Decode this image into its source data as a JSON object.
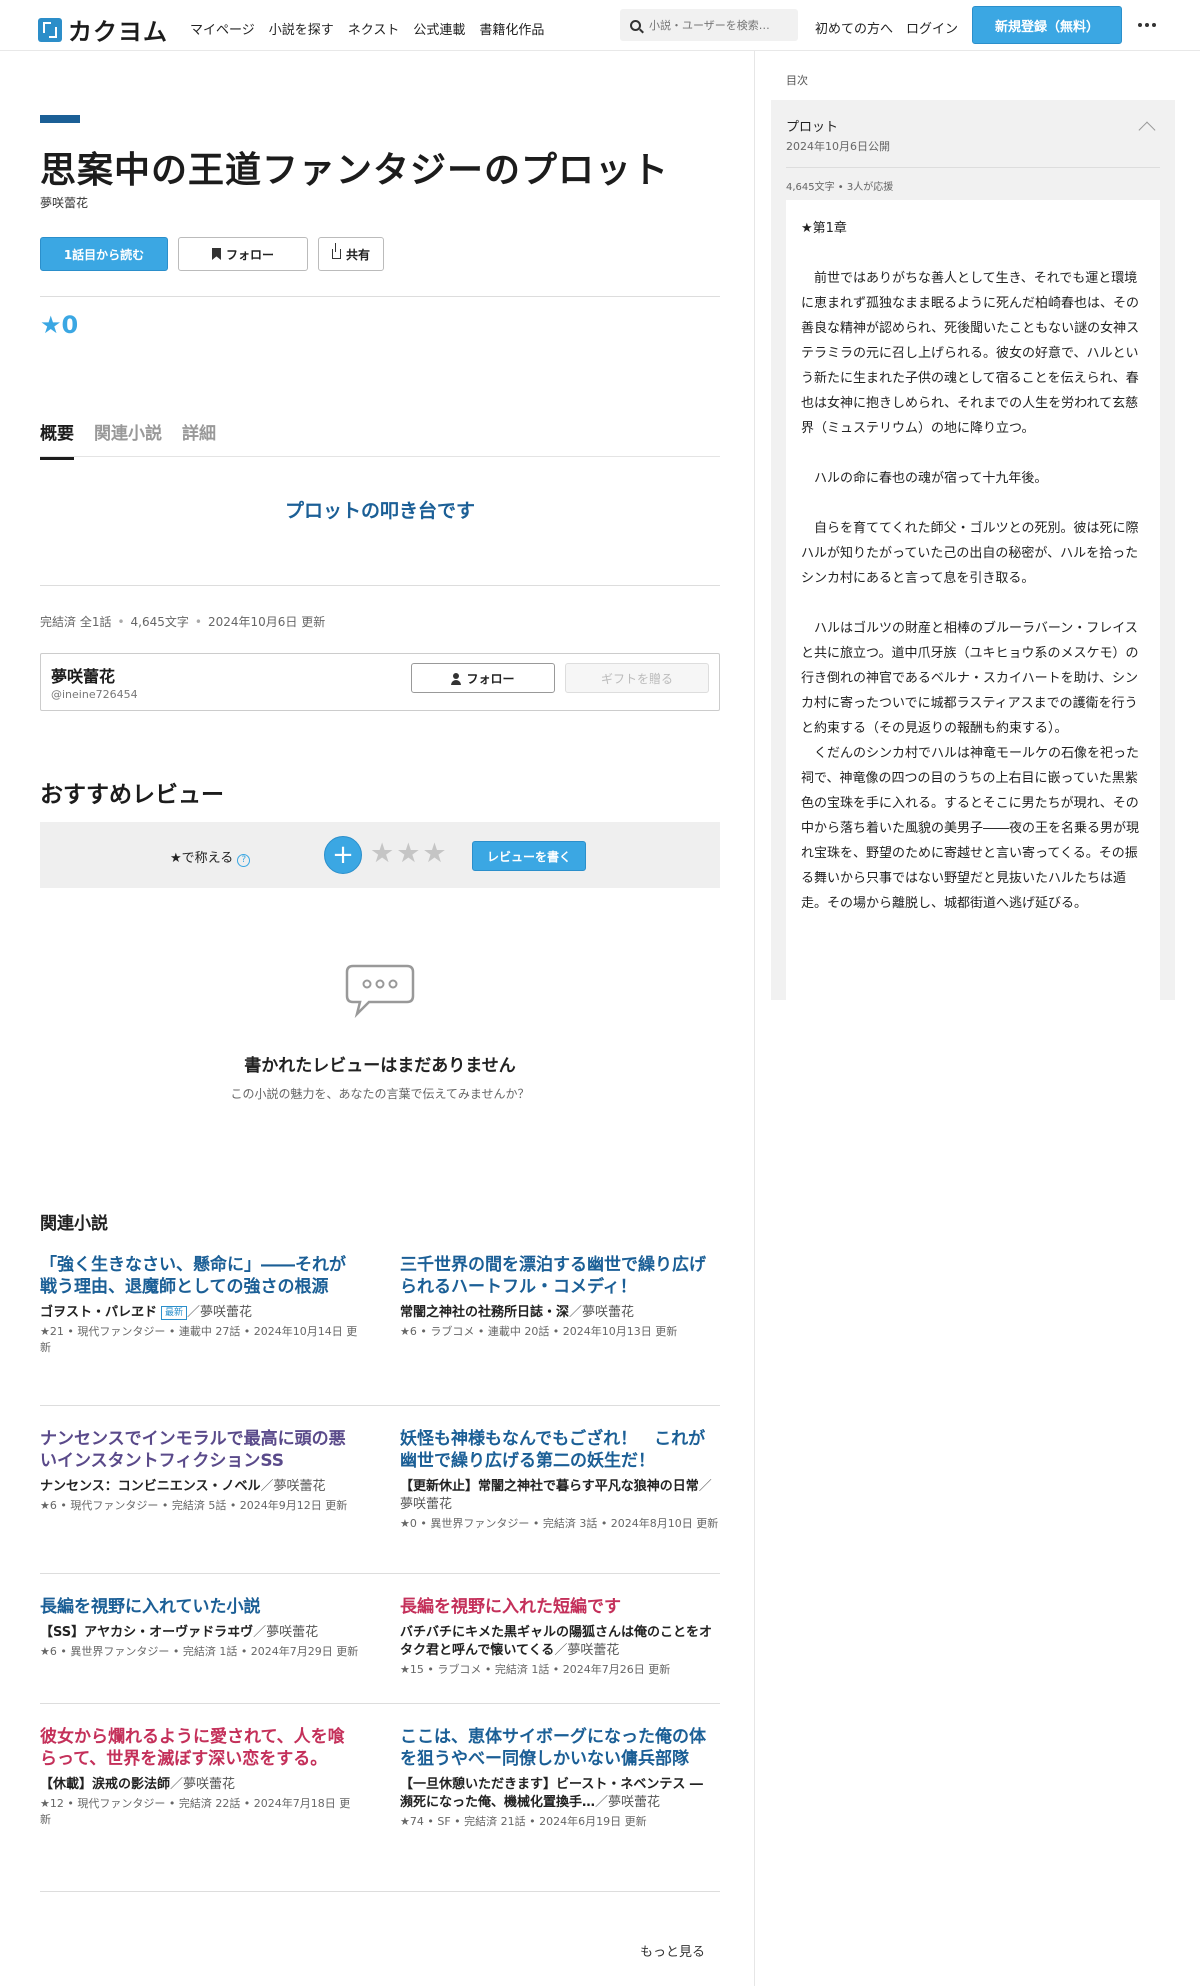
{
  "header": {
    "logo": "カクヨム",
    "nav": [
      "マイページ",
      "小説を探す",
      "ネクスト",
      "公式連載",
      "書籍化作品"
    ],
    "search_placeholder": "小説・ユーザーを検索…",
    "first_time": "初めての方へ",
    "login": "ログイン",
    "register": "新規登録（無料）"
  },
  "work": {
    "title": "思案中の王道ファンタジーのプロット",
    "author": "夢咲蕾花",
    "read_label": "1話目から読む",
    "follow_label": "フォロー",
    "share_label": "共有",
    "rating": "★0",
    "tabs": [
      "概要",
      "関連小説",
      "詳細"
    ],
    "catchphrase": "プロットの叩き台です",
    "meta": [
      "完結済 全1話",
      "4,645文字",
      "2024年10月6日 更新"
    ]
  },
  "author_box": {
    "name": "夢咲蕾花",
    "handle": "@ineine726454",
    "follow": "フォロー",
    "gift": "ギフトを贈る"
  },
  "reviews": {
    "heading": "おすすめレビュー",
    "praise": "★で称える",
    "help": "?",
    "plus": "+",
    "stars": "★★★",
    "write": "レビューを書く",
    "empty_title": "書かれたレビューはまだありません",
    "empty_sub": "この小説の魅力を、あなたの言葉で伝えてみませんか？"
  },
  "related": {
    "heading": "関連小説",
    "items": [
      {
        "title": "「強く生きなさい、懸命に」――それが戦う理由、退魔師としての強さの根源",
        "color": "#1b5f96",
        "series": "ゴヲスト・パレヱド",
        "badge": "最新",
        "by": "／夢咲蕾花",
        "meta": "★21 • 現代ファンタジー • 連載中 27話 • 2024年10月14日 更新"
      },
      {
        "title": "三千世界の間を漂泊する幽世で繰り広げられるハートフル・コメディ！",
        "color": "#1b5f96",
        "series": "常闇之神社の社務所日誌・深",
        "badge": "",
        "by": "／夢咲蕾花",
        "meta": "★6 • ラブコメ • 連載中 20話 • 2024年10月13日 更新"
      },
      {
        "title": "ナンセンスでインモラルで最高に頭の悪いインスタントフィクションSS",
        "color": "#5a4a8a",
        "series": "ナンセンス：コンビニエンス・ノベル",
        "badge": "",
        "by": "／夢咲蕾花",
        "meta": "★6 • 現代ファンタジー • 完結済 5話 • 2024年9月12日 更新"
      },
      {
        "title": "妖怪も神様もなんでもござれ！　これが幽世で繰り広げる第二の妖生だ！",
        "color": "#1b5f96",
        "series": "【更新休止】常闇之神社で暮らす平凡な狼神の日常",
        "badge": "",
        "by": "／夢咲蕾花",
        "meta": "★0 • 異世界ファンタジー • 完結済 3話 • 2024年8月10日 更新"
      },
      {
        "title": "長編を視野に入れていた小説",
        "color": "#1b5f96",
        "series": "【SS】アヤカシ・オーヴァドラヰヴ",
        "badge": "",
        "by": "／夢咲蕾花",
        "meta": "★6 • 異世界ファンタジー • 完結済 1話 • 2024年7月29日 更新"
      },
      {
        "title": "長編を視野に入れた短編です",
        "color": "#c4305a",
        "series": "バチバチにキメた黒ギャルの陽狐さんは俺のことをオタク君と呼んで懐いてくる",
        "badge": "",
        "by": "／夢咲蕾花",
        "meta": "★15 • ラブコメ • 完結済 1話 • 2024年7月26日 更新"
      },
      {
        "title": "彼女から爛れるように愛されて、人を喰らって、世界を滅ぼす深い恋をする。",
        "color": "#c4305a",
        "series": "【休載】涙戒の影法師",
        "badge": "",
        "by": "／夢咲蕾花",
        "meta": "★12 • 現代ファンタジー • 完結済 22話 • 2024年7月18日 更新"
      },
      {
        "title": "ここは、恵体サイボーグになった俺の体を狙うやべー同僚しかいない傭兵部隊",
        "color": "#1b5f96",
        "series": "【一旦休憩いただきます】ビースト・ネベンテス ― 瀕死になった俺、機械化置換手…",
        "badge": "",
        "by": "／夢咲蕾花",
        "meta": "★74 • SF • 完結済 21話 • 2024年6月19日 更新"
      }
    ],
    "more": "もっと見る"
  },
  "sidebar": {
    "label": "目次",
    "episode_title": "プロット",
    "episode_date": "2024年10月6日公開",
    "stats": "4,645文字 • 3人が応援",
    "body": "★第1章\n\n　前世ではありがちな善人として生き、それでも運と環境に恵まれず孤独なまま眠るように死んだ柏崎春也は、その善良な精神が認められ、死後聞いたこともない謎の女神ステラミラの元に召し上げられる。彼女の好意で、ハルという新たに生まれた子供の魂として宿ることを伝えられ、春也は女神に抱きしめられ、それまでの人生を労われて玄慈界（ミュステリウム）の地に降り立つ。\n\n　ハルの命に春也の魂が宿って十九年後。\n\n　自らを育ててくれた師父・ゴルツとの死別。彼は死に際ハルが知りたがっていた己の出自の秘密が、ハルを拾ったシンカ村にあると言って息を引き取る。\n\n　ハルはゴルツの財産と相棒のブルーラバーン・フレイスと共に旅立つ。道中爪牙族（ユキヒョウ系のメスケモ）の行き倒れの神官であるベルナ・スカイハートを助け、シンカ村に寄ったついでに城都ラスティアスまでの護衛を行うと約束する（その見返りの報酬も約束する）。\n　くだんのシンカ村でハルは神竜モールケの石像を祀った祠で、神竜像の四つの目のうちの上右目に嵌っていた黒紫色の宝珠を手に入れる。するとそこに男たちが現れ、その中から落ち着いた風貌の美男子――夜の王を名乗る男が現れ宝珠を、野望のために寄越せと言い寄ってくる。その振る舞いから只事ではない野望だと見抜いたハルたちは遁走。その場から離脱し、城都街道へ逃げ延びる。"
  }
}
